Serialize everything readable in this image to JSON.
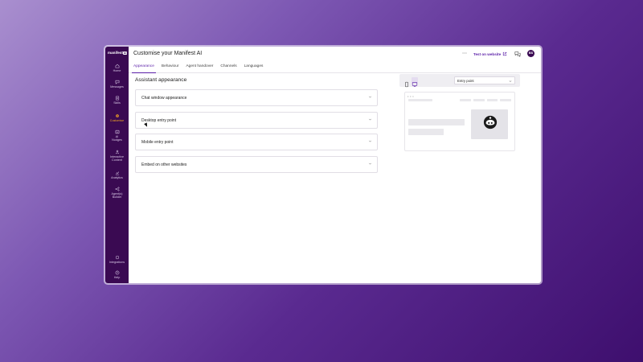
{
  "brand": {
    "name": "manifest",
    "ai_badge": "AI"
  },
  "sidebar": {
    "items": [
      {
        "label": "Home",
        "icon": "home-icon"
      },
      {
        "label": "Messages",
        "icon": "messages-icon"
      },
      {
        "label": "Skills",
        "icon": "skills-icon"
      },
      {
        "label": "Customise",
        "icon": "customise-icon",
        "active": true
      },
      {
        "label": "AI\nNudges",
        "icon": "ai-nudges-icon"
      },
      {
        "label": "Interactive\nContent",
        "icon": "interactive-content-icon"
      },
      {
        "label": "Analytics",
        "icon": "analytics-icon"
      },
      {
        "label": "Agent(s)\nBuilder",
        "icon": "agents-builder-icon"
      },
      {
        "label": "Integrations",
        "icon": "integrations-icon"
      },
      {
        "label": "Help",
        "icon": "help-icon"
      }
    ]
  },
  "header": {
    "title": "Customise your Manifest AI",
    "test_label": "Test on website",
    "avatar_initials": "BS"
  },
  "tabs": [
    {
      "label": "Appearance",
      "active": true
    },
    {
      "label": "Behaviour"
    },
    {
      "label": "Agent handover"
    },
    {
      "label": "Channels"
    },
    {
      "label": "Languages"
    }
  ],
  "section": {
    "title": "Assistant appearance"
  },
  "accordions": [
    {
      "label": "Chat window appearance"
    },
    {
      "label": "Desktop entry point"
    },
    {
      "label": "Mobile entry point"
    },
    {
      "label": "Embed on other websites"
    }
  ],
  "preview": {
    "select_value": "Entry point"
  },
  "colors": {
    "sidebar_bg": "#3a0a52",
    "accent": "#5b1fa8",
    "active_nav": "#f4a623"
  }
}
